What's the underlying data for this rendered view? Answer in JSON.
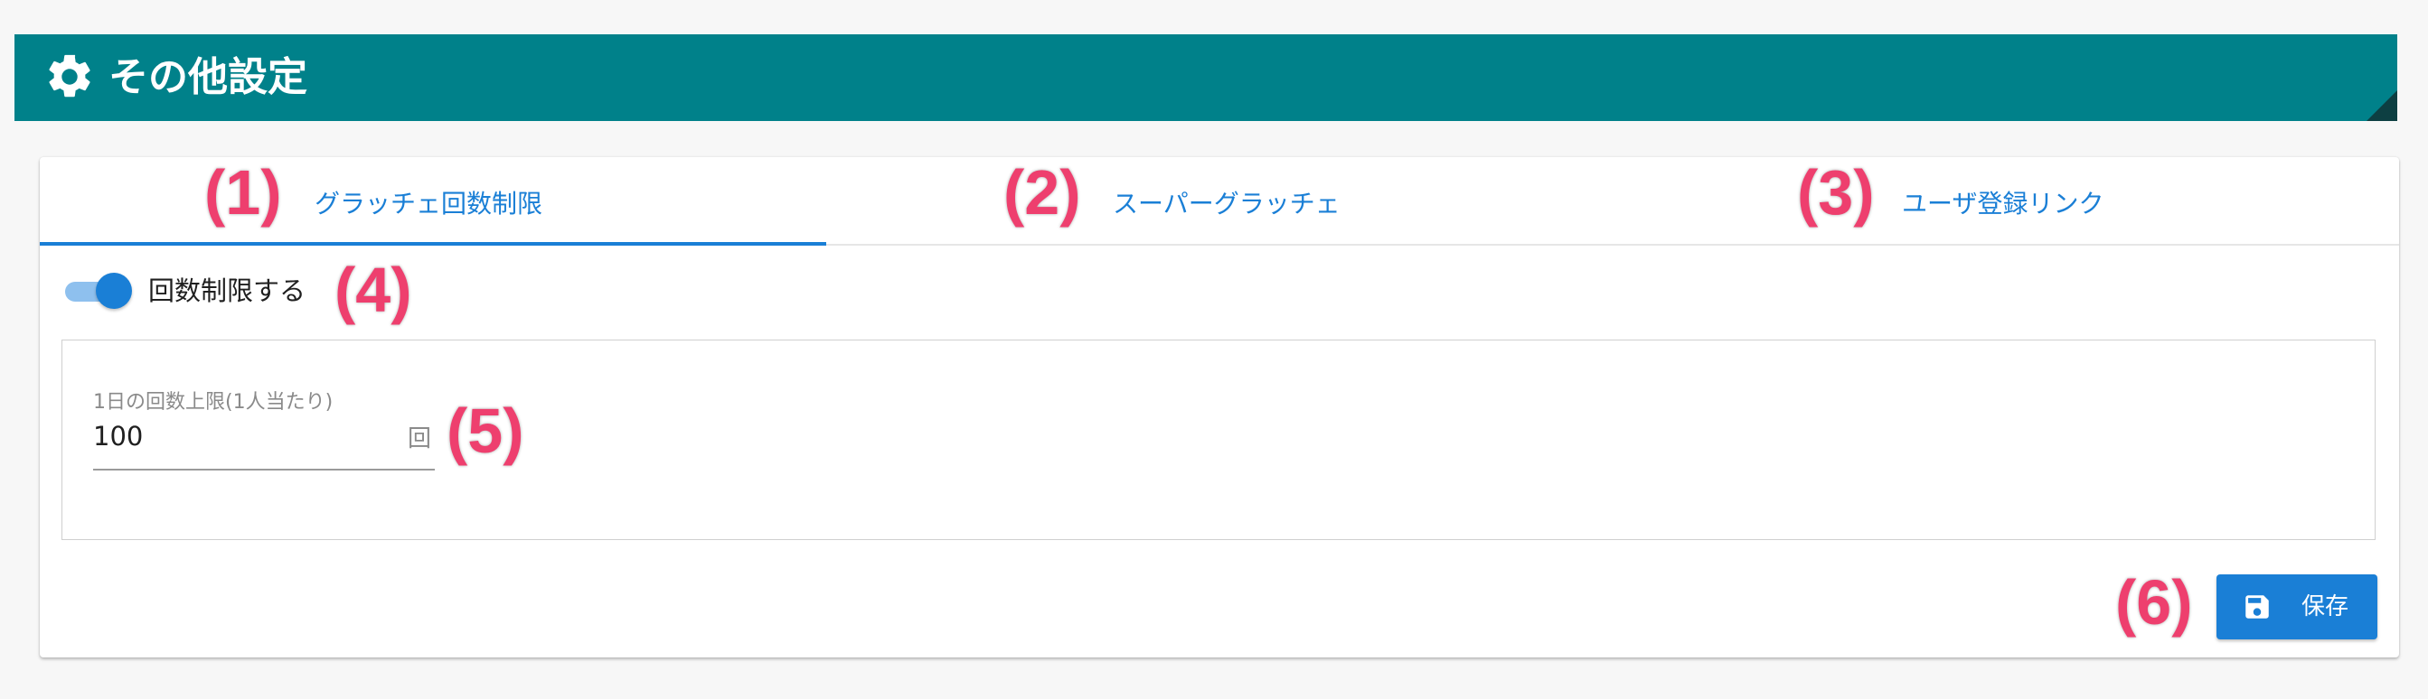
{
  "header": {
    "title": "その他設定",
    "icon": "gear-icon",
    "color": "#00818a"
  },
  "tabs": [
    {
      "label": "グラッチェ回数制限",
      "active": true
    },
    {
      "label": "スーパーグラッチェ",
      "active": false
    },
    {
      "label": "ユーザ登録リンク",
      "active": false
    }
  ],
  "toggle": {
    "label": "回数制限する",
    "checked": true
  },
  "limit_field": {
    "label": "1日の回数上限(1人当たり)",
    "value": "100",
    "suffix": "回"
  },
  "save_button": {
    "label": "保存",
    "icon": "floppy-disk-icon",
    "color": "#1a7fd6"
  },
  "callouts": [
    "(1)",
    "(2)",
    "(3)",
    "(4)",
    "(5)",
    "(6)"
  ]
}
